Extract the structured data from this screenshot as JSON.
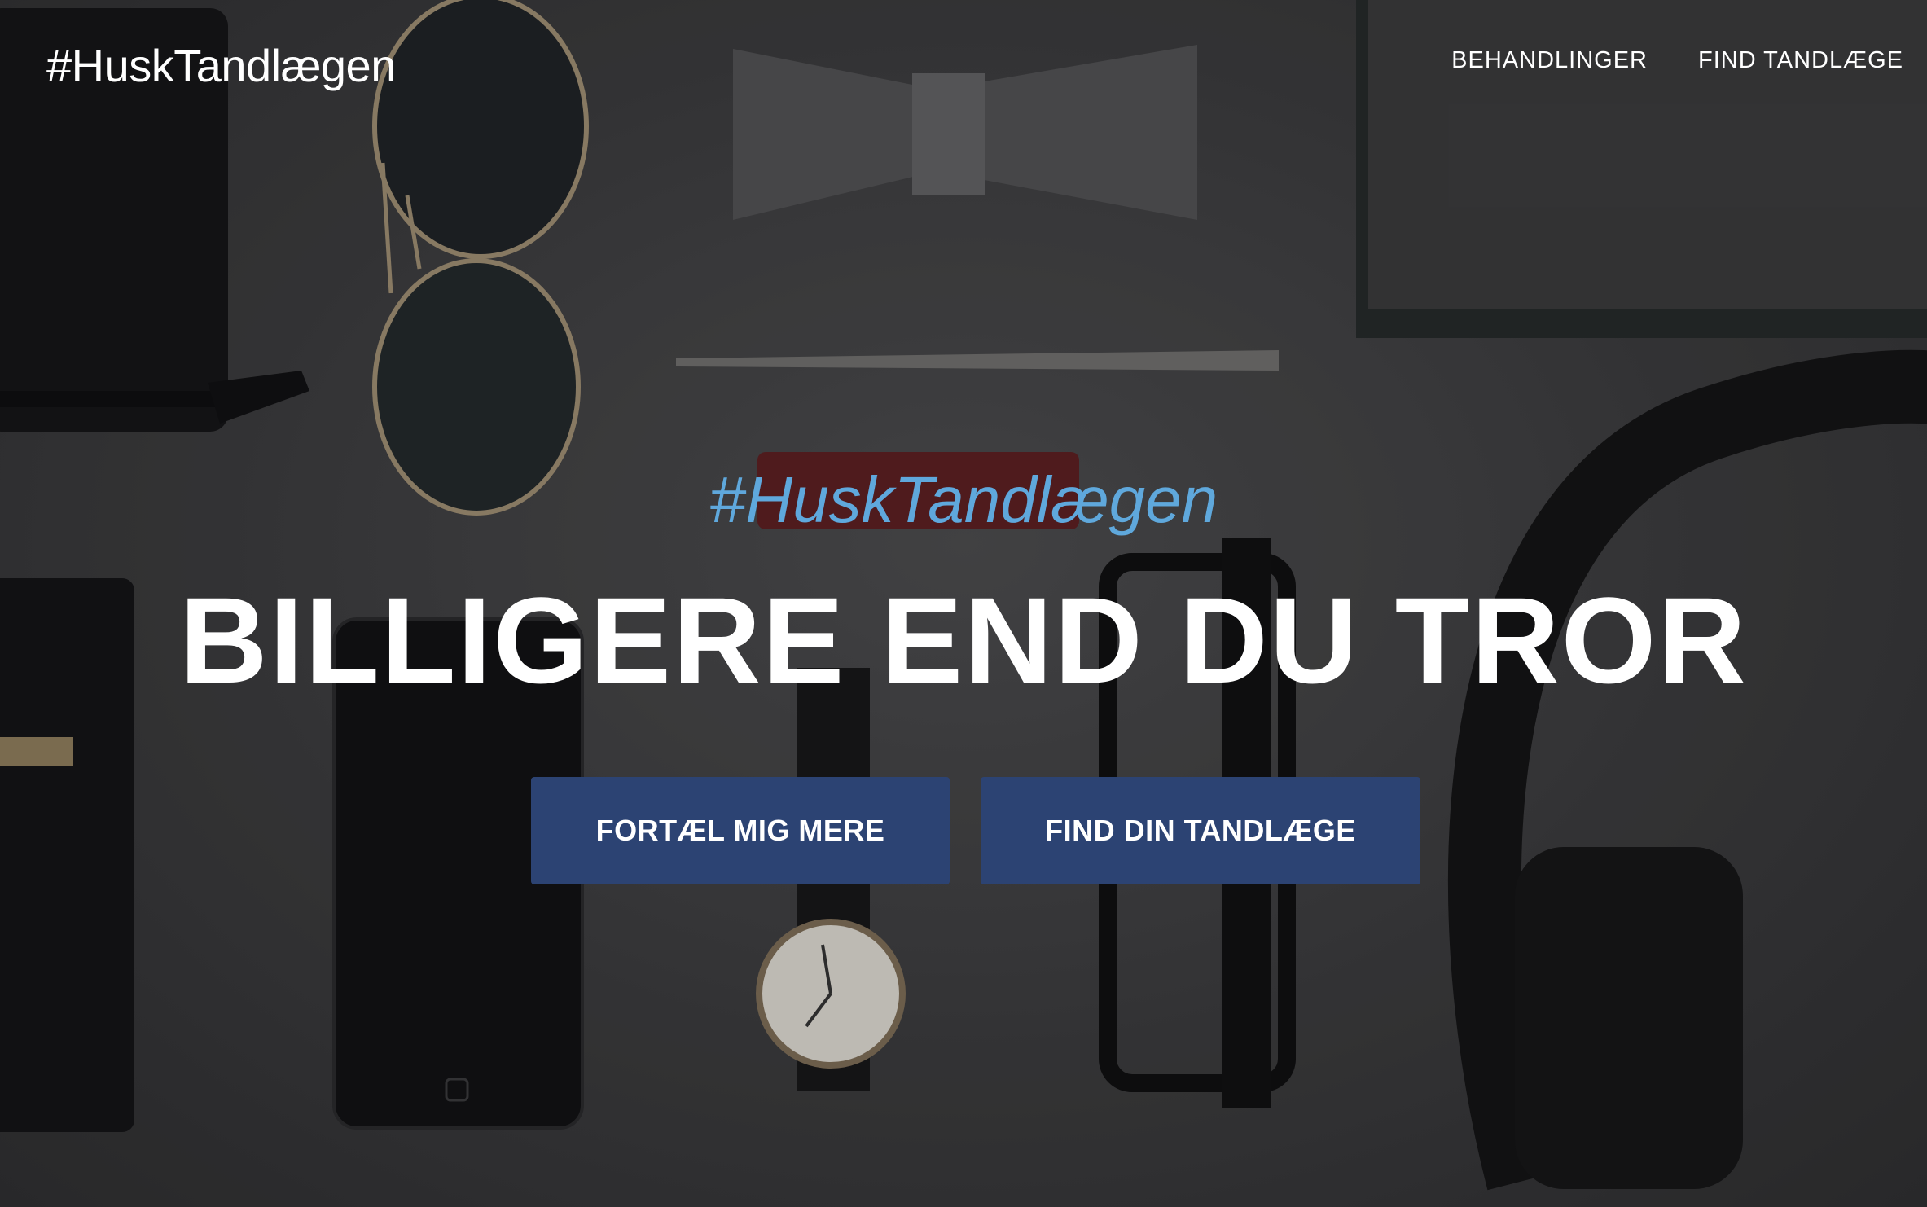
{
  "brand": "#HuskTandlægen",
  "nav": {
    "items": [
      "BEHANDLINGER",
      "FIND TANDLÆGE"
    ]
  },
  "hero": {
    "subheading": "#HuskTandlægen",
    "headline": "BILLIGERE END DU TROR",
    "buttons": {
      "more": "FORTÆL MIG MERE",
      "find": "FIND DIN TANDLÆGE"
    }
  },
  "colors": {
    "button_bg": "#2c4373",
    "subheading": "#5fa8dc",
    "text": "#ffffff"
  }
}
